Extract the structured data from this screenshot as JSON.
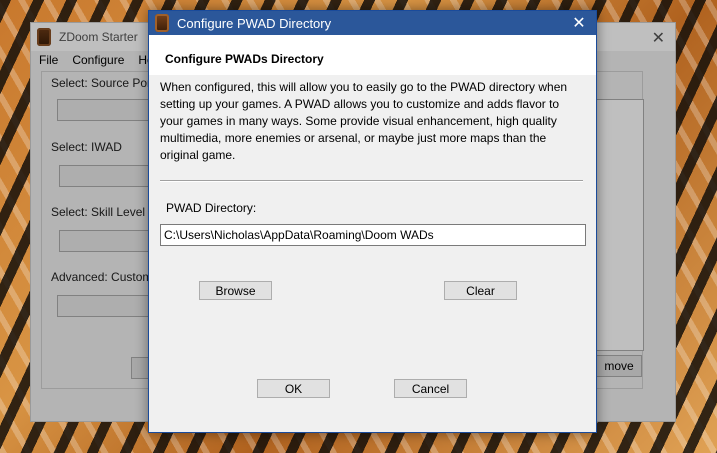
{
  "background_window": {
    "title": "ZDoom Starter",
    "close_glyph": "✕",
    "menu": [
      "File",
      "Configure",
      "He"
    ],
    "labels": {
      "source_port": "Select: Source Port",
      "iwad": "Select: IWAD",
      "skill": "Select: Skill Level",
      "advanced": "Advanced: Custom"
    },
    "remove_label": "move"
  },
  "dialog": {
    "title": "Configure PWAD Directory",
    "close_glyph": "✕",
    "heading": "Configure PWADs Directory",
    "description": "When configured, this will allow you to easily go to the PWAD directory when setting up your games.  A PWAD allows you to customize and adds flavor to your games in many ways.  Some provide visual enhancement, high quality multimedia, more enemies or arsenal, or maybe just more maps than the original game.",
    "dir_label": "PWAD Directory:",
    "dir_value": "C:\\Users\\Nicholas\\AppData\\Roaming\\Doom WADs",
    "browse_label": "Browse",
    "clear_label": "Clear",
    "ok_label": "OK",
    "cancel_label": "Cancel"
  },
  "icons": {
    "app_icon": "doom-app-icon",
    "close": "close-icon"
  }
}
